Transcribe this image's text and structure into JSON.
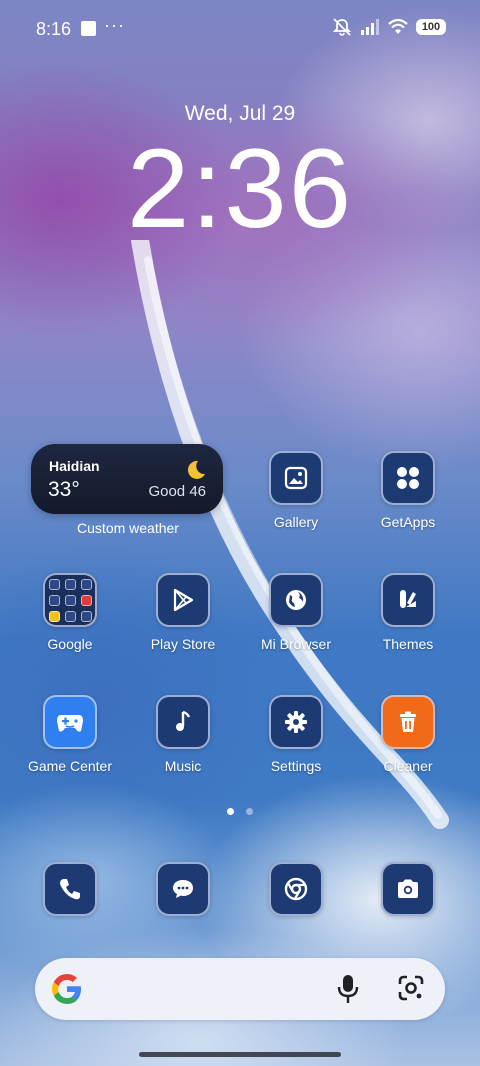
{
  "status_bar": {
    "time": "8:16",
    "notification_dots": "···",
    "battery": "100"
  },
  "lockclock": {
    "date": "Wed, Jul 29",
    "time": "2:36"
  },
  "weather_widget": {
    "city": "Haidian",
    "temperature": "33°",
    "air_quality": "Good 46",
    "label": "Custom weather",
    "icon": "crescent-moon-icon"
  },
  "apps": [
    {
      "label": "Gallery",
      "icon": "image-icon"
    },
    {
      "label": "GetApps",
      "icon": "four-dots-icon"
    },
    {
      "label": "Google",
      "icon": "folder-icon"
    },
    {
      "label": "Play Store",
      "icon": "play-triangle-icon"
    },
    {
      "label": "Mi Browser",
      "icon": "globe-icon"
    },
    {
      "label": "Themes",
      "icon": "brush-icon"
    },
    {
      "label": "Game Center",
      "icon": "gamepad-icon"
    },
    {
      "label": "Music",
      "icon": "music-note-icon"
    },
    {
      "label": "Settings",
      "icon": "gear-icon"
    },
    {
      "label": "Cleaner",
      "icon": "trash-icon"
    }
  ],
  "dock": [
    "phone-icon",
    "message-icon",
    "chrome-icon",
    "camera-icon"
  ],
  "pager": {
    "pages": 2,
    "active": 1
  },
  "colors": {
    "icon_bg": "#1e3a72",
    "cleaner_orange": "#f06a1a",
    "game_center_blue": "#2f7ff0",
    "search_bg": "#eef1f8"
  }
}
